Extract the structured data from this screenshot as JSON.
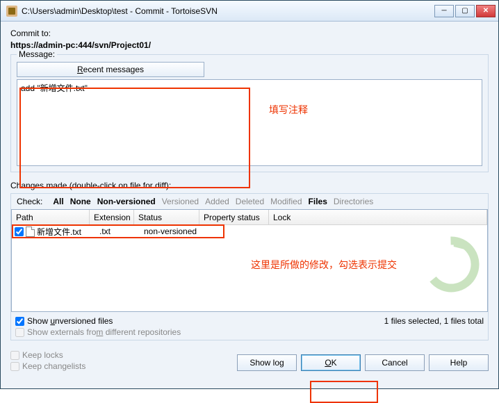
{
  "title": "C:\\Users\\admin\\Desktop\\test - Commit - TortoiseSVN",
  "commit_to_label": "Commit to:",
  "commit_url": "https://admin-pc:444/svn/Project01/",
  "message_group": "Message:",
  "recent_messages_btn": {
    "prefix": "",
    "underlined": "R",
    "suffix": "ecent messages"
  },
  "message_text": "add \"新增文件.txt\"",
  "annotation_msg": "填写注释",
  "changes_label": "Changes made (double-click on file for diff):",
  "filters": {
    "check": "Check:",
    "all": "All",
    "none": "None",
    "nonver": "Non-versioned",
    "versioned": "Versioned",
    "added": "Added",
    "deleted": "Deleted",
    "modified": "Modified",
    "files": "Files",
    "directories": "Directories"
  },
  "columns": {
    "path": "Path",
    "ext": "Extension",
    "status": "Status",
    "prop": "Property status",
    "lock": "Lock"
  },
  "rows": [
    {
      "checked": true,
      "name": "新增文件.txt",
      "ext": ".txt",
      "status": "non-versioned"
    }
  ],
  "annotation_files": "这里是所做的修改，勾选表示提交",
  "show_unversioned": {
    "prefix": "Show ",
    "underlined": "u",
    "suffix": "nversioned files"
  },
  "show_externals": {
    "prefix": "Show externals fro",
    "underlined": "m",
    "suffix": " different repositories"
  },
  "selection_info": "1 files selected, 1 files total",
  "keep_locks": "Keep locks",
  "keep_changelists": "Keep changelists",
  "buttons": {
    "showlog": "Show log",
    "ok_u": "O",
    "ok_rest": "K",
    "cancel": "Cancel",
    "help": "Help"
  }
}
